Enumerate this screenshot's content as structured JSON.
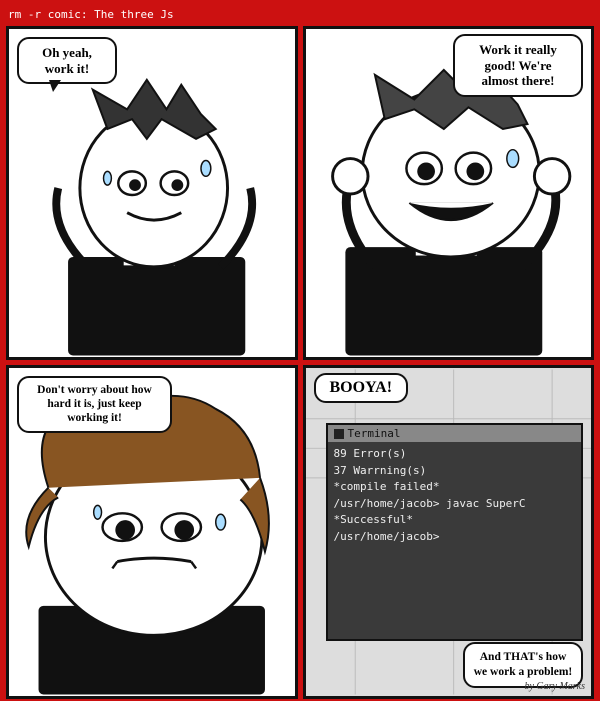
{
  "title": "rm -r comic: The three Js",
  "panel1": {
    "speech": "Oh yeah, work it!"
  },
  "panel2": {
    "speech": "Work it really good! We're almost there!"
  },
  "panel3": {
    "speech": "Don't worry about how hard it is, just keep working it!"
  },
  "panel4": {
    "booya": "BOOYA!",
    "terminal_title": "Terminal",
    "terminal_lines": [
      "89 Error(s)",
      "37 Warrning(s)",
      "*compile failed*",
      "/usr/home/jacob> javac SuperC",
      "*Successful*",
      "/usr/home/jacob>"
    ],
    "bottom_speech": "And THAT's how we work a problem!",
    "byline": "by Gary Marks"
  }
}
